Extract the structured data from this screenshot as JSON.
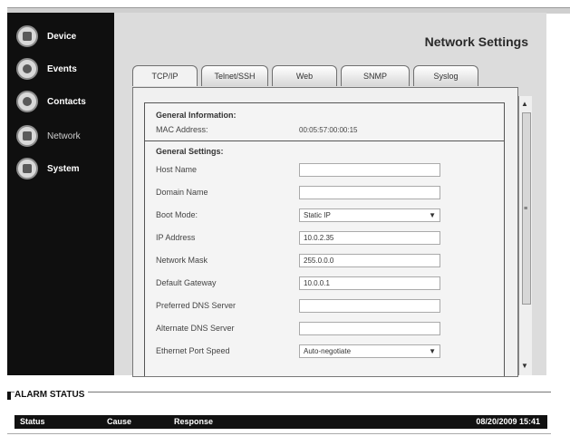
{
  "header": {
    "title": "Network Settings"
  },
  "sidebar": {
    "items": [
      {
        "label": "Device",
        "icon": "device-icon"
      },
      {
        "label": "Events",
        "icon": "events-icon"
      },
      {
        "label": "Contacts",
        "icon": "contacts-icon"
      },
      {
        "label": "Network",
        "icon": "network-icon"
      },
      {
        "label": "System",
        "icon": "system-icon"
      }
    ]
  },
  "tabs": [
    {
      "label": "TCP/IP"
    },
    {
      "label": "Telnet/SSH"
    },
    {
      "label": "Web"
    },
    {
      "label": "SNMP"
    },
    {
      "label": "Syslog"
    }
  ],
  "general_information": {
    "title": "General Information:",
    "mac_label": "MAC Address:",
    "mac_value": "00:05:57:00:00:15"
  },
  "general_settings": {
    "title": "General Settings:",
    "fields": [
      {
        "label": "Host Name",
        "value": ""
      },
      {
        "label": "Domain Name",
        "value": ""
      },
      {
        "label": "Boot Mode:",
        "value": "Static IP"
      },
      {
        "label": "IP Address",
        "value": "10.0.2.35"
      },
      {
        "label": "Network Mask",
        "value": "255.0.0.0"
      },
      {
        "label": "Default Gateway",
        "value": "10.0.0.1"
      },
      {
        "label": "Preferred DNS Server",
        "value": ""
      },
      {
        "label": "Alternate DNS Server",
        "value": ""
      },
      {
        "label": "Ethernet Port Speed",
        "value": "Auto-negotiate"
      }
    ]
  },
  "alarm": {
    "title": "ALARM STATUS",
    "columns": [
      "Status",
      "Cause",
      "Response"
    ],
    "timestamp": "08/20/2009 15:41"
  },
  "scrollbar": {
    "up": "▲",
    "down": "▼",
    "grip": "≡"
  },
  "colors": {
    "sidebar_bg": "#0f0f0f",
    "panel_bg": "#dcdcdc"
  }
}
